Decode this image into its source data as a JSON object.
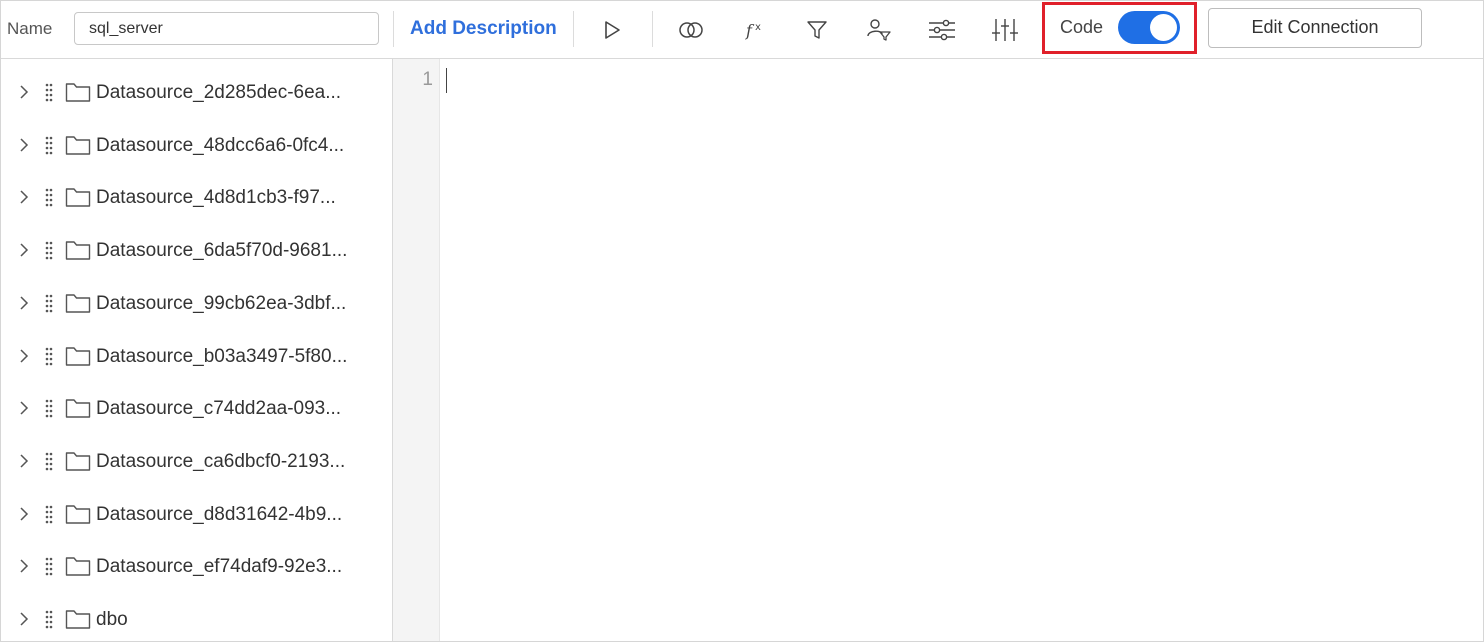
{
  "toolbar": {
    "name_label": "Name",
    "name_value": "sql_server",
    "add_description": "Add Description",
    "code_label": "Code",
    "code_toggle_on": true,
    "edit_connection": "Edit Connection",
    "icons": [
      "run-icon",
      "join-icon",
      "function-icon",
      "filter-icon",
      "user-filter-icon",
      "sliders-icon",
      "columns-settings-icon"
    ]
  },
  "tree": {
    "items": [
      {
        "label": "Datasource_2d285dec-6ea..."
      },
      {
        "label": "Datasource_48dcc6a6-0fc4..."
      },
      {
        "label": "Datasource_4d8d1cb3-f97..."
      },
      {
        "label": "Datasource_6da5f70d-9681..."
      },
      {
        "label": "Datasource_99cb62ea-3dbf..."
      },
      {
        "label": "Datasource_b03a3497-5f80..."
      },
      {
        "label": "Datasource_c74dd2aa-093..."
      },
      {
        "label": "Datasource_ca6dbcf0-2193..."
      },
      {
        "label": "Datasource_d8d31642-4b9..."
      },
      {
        "label": "Datasource_ef74daf9-92e3..."
      },
      {
        "label": "dbo"
      }
    ]
  },
  "editor": {
    "line_number": "1",
    "content": ""
  },
  "colors": {
    "accent": "#2f6fdc",
    "toggle": "#1f6fe5",
    "highlight_box": "#e0202a"
  }
}
